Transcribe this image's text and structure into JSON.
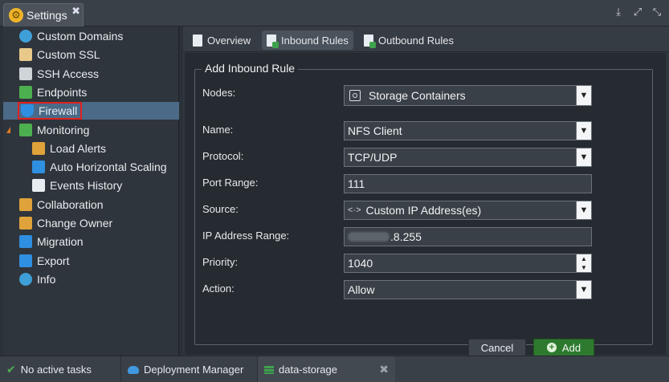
{
  "window": {
    "title": "Settings",
    "close_glyph": "✖",
    "tools": [
      "⤓",
      "⤢",
      "⤡"
    ]
  },
  "sidebar": {
    "items": [
      {
        "label": "Custom Domains",
        "icon": "globe-icon",
        "color": "#3f9fd8",
        "indent": 0
      },
      {
        "label": "Custom SSL",
        "icon": "certificate-icon",
        "color": "#e8c98a",
        "indent": 0
      },
      {
        "label": "SSH Access",
        "icon": "terminal-icon",
        "color": "#cfd4d9",
        "indent": 0
      },
      {
        "label": "Endpoints",
        "icon": "endpoints-icon",
        "color": "#4cb050",
        "indent": 0
      },
      {
        "label": "Firewall",
        "icon": "shield-icon",
        "color": "#2f8fe0",
        "indent": 0,
        "selected": true
      },
      {
        "label": "Monitoring",
        "icon": "monitor-icon",
        "color": "#4cb050",
        "indent": 0,
        "expanded": true
      },
      {
        "label": "Load Alerts",
        "icon": "mail-alert-icon",
        "color": "#e0a23a",
        "indent": 1
      },
      {
        "label": "Auto Horizontal Scaling",
        "icon": "scaling-icon",
        "color": "#2f8fe0",
        "indent": 1
      },
      {
        "label": "Events History",
        "icon": "document-icon",
        "color": "#e8edf2",
        "indent": 1
      },
      {
        "label": "Collaboration",
        "icon": "users-icon",
        "color": "#e0a23a",
        "indent": 0
      },
      {
        "label": "Change Owner",
        "icon": "user-switch-icon",
        "color": "#e0a23a",
        "indent": 0
      },
      {
        "label": "Migration",
        "icon": "migration-icon",
        "color": "#2f8fe0",
        "indent": 0
      },
      {
        "label": "Export",
        "icon": "export-icon",
        "color": "#2f8fe0",
        "indent": 0
      },
      {
        "label": "Info",
        "icon": "info-icon",
        "color": "#3f9fd8",
        "indent": 0
      }
    ]
  },
  "tabs": [
    {
      "label": "Overview",
      "active": false
    },
    {
      "label": "Inbound Rules",
      "active": true
    },
    {
      "label": "Outbound Rules",
      "active": false
    }
  ],
  "form": {
    "legend": "Add Inbound Rule",
    "nodes_label": "Nodes:",
    "nodes_value": "Storage Containers",
    "name_label": "Name:",
    "name_value": "NFS Client",
    "protocol_label": "Protocol:",
    "protocol_value": "TCP/UDP",
    "port_label": "Port Range:",
    "port_value": "111",
    "source_label": "Source:",
    "source_value": "Custom IP Address(es)",
    "ip_label": "IP Address Range:",
    "ip_value_visible": ".8.255",
    "priority_label": "Priority:",
    "priority_value": "1040",
    "action_label": "Action:",
    "action_value": "Allow",
    "cancel_label": "Cancel",
    "add_label": "Add"
  },
  "taskbar": {
    "status": "No active tasks",
    "deployment_manager": "Deployment Manager",
    "environment": "data-storage"
  }
}
